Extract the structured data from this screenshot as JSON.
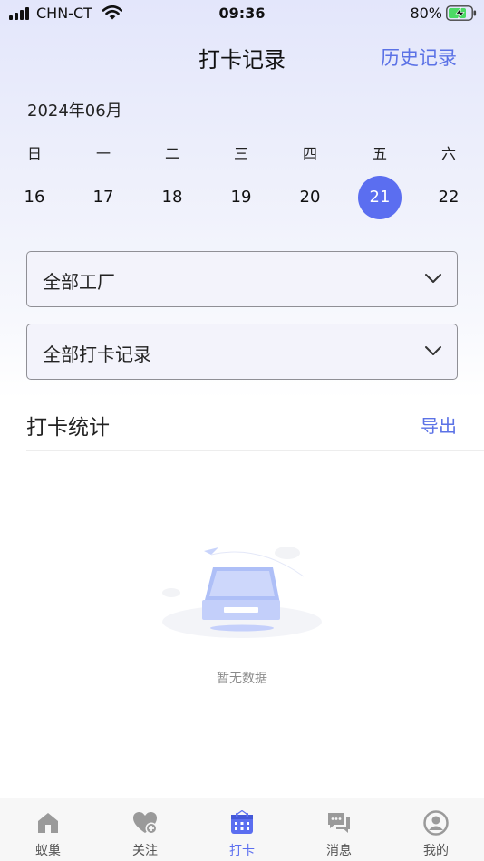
{
  "status_bar": {
    "carrier": "CHN-CT",
    "time": "09:36",
    "battery": "80%"
  },
  "nav": {
    "title": "打卡记录",
    "history": "历史记录"
  },
  "calendar": {
    "month": "2024年06月",
    "weekdays": [
      "日",
      "一",
      "二",
      "三",
      "四",
      "五",
      "六"
    ],
    "dates": [
      "16",
      "17",
      "18",
      "19",
      "20",
      "21",
      "22"
    ],
    "selected": "21",
    "accent": "#5b6ef0"
  },
  "filters": {
    "factory": "全部工厂",
    "record": "全部打卡记录"
  },
  "stats": {
    "title": "打卡统计",
    "export": "导出"
  },
  "empty": {
    "text": "暂无数据"
  },
  "tabbar": {
    "items": [
      {
        "label": "蚁巢",
        "icon": "home-icon"
      },
      {
        "label": "关注",
        "icon": "heart-plus-icon"
      },
      {
        "label": "打卡",
        "icon": "calendar-icon"
      },
      {
        "label": "消息",
        "icon": "chat-icon"
      },
      {
        "label": "我的",
        "icon": "user-icon"
      }
    ],
    "active": "打卡",
    "active_color": "#5b6ef0",
    "inactive_color": "#9a9a9a"
  }
}
